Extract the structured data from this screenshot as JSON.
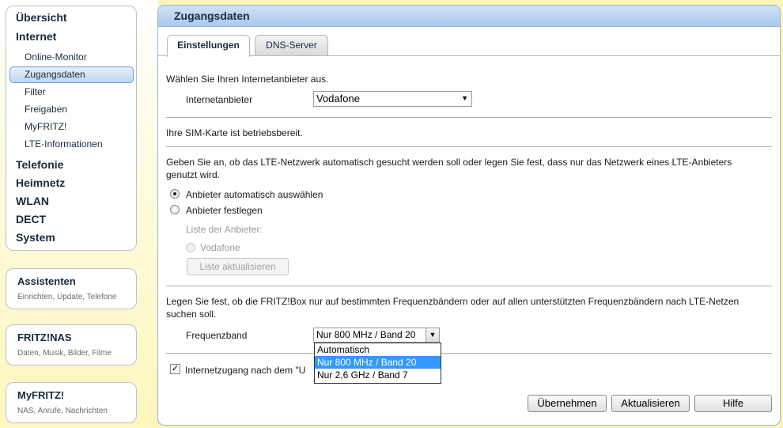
{
  "nav": {
    "items": [
      {
        "label": "Übersicht"
      },
      {
        "label": "Internet"
      },
      {
        "label": "Online-Monitor"
      },
      {
        "label": "Zugangsdaten"
      },
      {
        "label": "Filter"
      },
      {
        "label": "Freigaben"
      },
      {
        "label": "MyFRITZ!"
      },
      {
        "label": "LTE-Informationen"
      },
      {
        "label": "Telefonie"
      },
      {
        "label": "Heimnetz"
      },
      {
        "label": "WLAN"
      },
      {
        "label": "DECT"
      },
      {
        "label": "System"
      }
    ],
    "active": "Zugangsdaten"
  },
  "boxes": [
    {
      "title": "Assistenten",
      "subtitle": "Einrichten, Update, Telefone"
    },
    {
      "title": "FRITZ!NAS",
      "subtitle": "Daten, Musik, Bilder, Filme"
    },
    {
      "title": "MyFRITZ!",
      "subtitle": "NAS, Anrufe, Nachrichten"
    }
  ],
  "page": {
    "title": "Zugangsdaten",
    "tabs": [
      "Einstellungen",
      "DNS-Server"
    ],
    "provider_prompt": "Wählen Sie Ihren Internetanbieter aus.",
    "provider_label": "Internetanbieter",
    "provider_value": "Vodafone",
    "sim_status": "Ihre SIM-Karte ist betriebsbereit.",
    "network_text": "Geben Sie an, ob das LTE-Netzwerk automatisch gesucht werden soll oder legen Sie fest, dass nur das Netzwerk eines LTE-Anbieters genutzt wird.",
    "radio_auto": "Anbieter automatisch auswählen",
    "radio_fixed": "Anbieter festlegen",
    "provider_list_label": "Liste der Anbieter:",
    "provider_list_item": "Vodafone",
    "refresh_list": "Liste aktualisieren",
    "band_text": "Legen Sie fest, ob die FRITZ!Box nur auf bestimmten Frequenzbändern oder auf allen unterstützten Frequenzbändern nach LTE-Netzen suchen soll.",
    "band_label": "Frequenzband",
    "band_value": "Nur 800 MHz / Band 20",
    "band_options": [
      "Automatisch",
      "Nur 800 MHz / Band 20",
      "Nur 2,6 GHz / Band 7"
    ],
    "internet_access_text": "Internetzugang nach dem \"U",
    "buttons": {
      "apply": "Übernehmen",
      "refresh": "Aktualisieren",
      "help": "Hilfe"
    }
  }
}
